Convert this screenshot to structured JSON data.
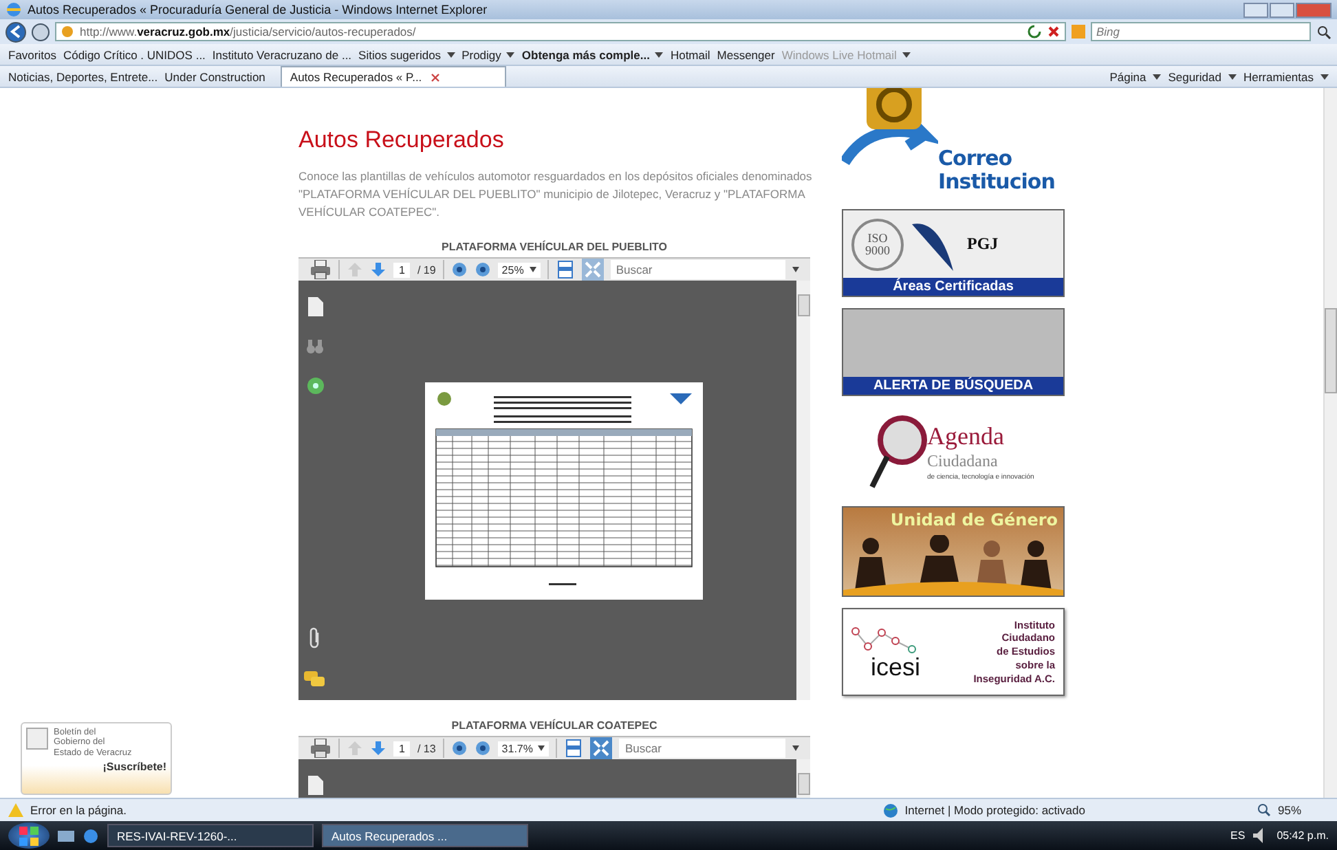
{
  "window": {
    "title": "Autos Recuperados « Procuraduría General de Justicia - Windows Internet Explorer"
  },
  "address_bar": {
    "url": "http://www.**veracruz.gob.mx**/justicia/servicio/autos-recuperados/"
  },
  "search_box": {
    "placeholder": "Bing"
  },
  "favorites_bar": {
    "label": "Favoritos",
    "items": [
      {
        "label": "Código Crítico . UNIDOS ...",
        "dropdown": false,
        "emphasized": false,
        "disabled": false
      },
      {
        "label": "Instituto Veracruzano de ...",
        "dropdown": false,
        "emphasized": false,
        "disabled": false
      },
      {
        "label": "Sitios sugeridos",
        "dropdown": true,
        "emphasized": false,
        "disabled": false
      },
      {
        "label": "Prodigy",
        "dropdown": true,
        "emphasized": false,
        "disabled": false
      },
      {
        "label": "Obtenga más comple...",
        "dropdown": true,
        "emphasized": true,
        "disabled": false
      },
      {
        "label": "Hotmail",
        "dropdown": false,
        "emphasized": false,
        "disabled": false
      },
      {
        "label": "Messenger",
        "dropdown": false,
        "emphasized": false,
        "disabled": false
      },
      {
        "label": "Windows Live Hotmail",
        "dropdown": true,
        "emphasized": false,
        "disabled": true
      }
    ]
  },
  "quick_links": [
    "Noticias, Deportes, Entrete...",
    "Under Construction"
  ],
  "tabs": [
    {
      "label": "Autos Recuperados « P...",
      "selected": true
    }
  ],
  "command_bar": [
    "Página",
    "Seguridad",
    "Herramientas"
  ],
  "page": {
    "heading": "Autos Recuperados",
    "intro": "Conoce las plantillas de vehículos automotor resguardados en los depósitos oficiales denominados \"PLATAFORMA VEHÍCULAR DEL PUEBLITO\" municipio de Jilotepec, Veracruz y \"PLATAFORMA VEHÍCULAR COATEPEC\".",
    "viewers": [
      {
        "title": "PLATAFORMA VEHÍCULAR DEL PUEBLITO",
        "page": "1",
        "total": "/ 19",
        "zoom": "25%",
        "search_placeholder": "Buscar",
        "fit_selected": false
      },
      {
        "title": "PLATAFORMA VEHÍCULAR COATEPEC",
        "page": "1",
        "total": "/ 13",
        "zoom": "31.7%",
        "search_placeholder": "Buscar",
        "fit_selected": true
      }
    ],
    "newsletter": {
      "lines": [
        "Boletín del",
        "Gobierno del",
        "Estado de Veracruz"
      ],
      "action": "¡Suscríbete!"
    },
    "banners": {
      "mail": [
        "Correo",
        "Institucion"
      ],
      "certified": {
        "seal": [
          "ISO",
          "9000"
        ],
        "logo": "PGJ",
        "caption": "Áreas Certificadas"
      },
      "alert": {
        "caption": "ALERTA DE BÚSQUEDA"
      },
      "agenda": {
        "title": "Agenda",
        "subtitle": "Ciudadana",
        "tagline": "de ciencia, tecnología e innovación"
      },
      "gender": {
        "caption": "Unidad de Género"
      },
      "icesi": {
        "logo": "icesi",
        "lines": [
          "Instituto",
          "Ciudadano",
          "de Estudios",
          "sobre la",
          "Inseguridad A.C."
        ]
      }
    }
  },
  "status_bar": {
    "message": "Error en la página.",
    "zone": "Internet | Modo protegido: activado",
    "zoom": "95%"
  },
  "taskbar": {
    "buttons": [
      {
        "label": "RES-IVAI-REV-1260-...",
        "selected": false
      },
      {
        "label": "Autos Recuperados ...",
        "selected": true
      }
    ],
    "language": "ES",
    "clock": "05:42 p.m."
  }
}
